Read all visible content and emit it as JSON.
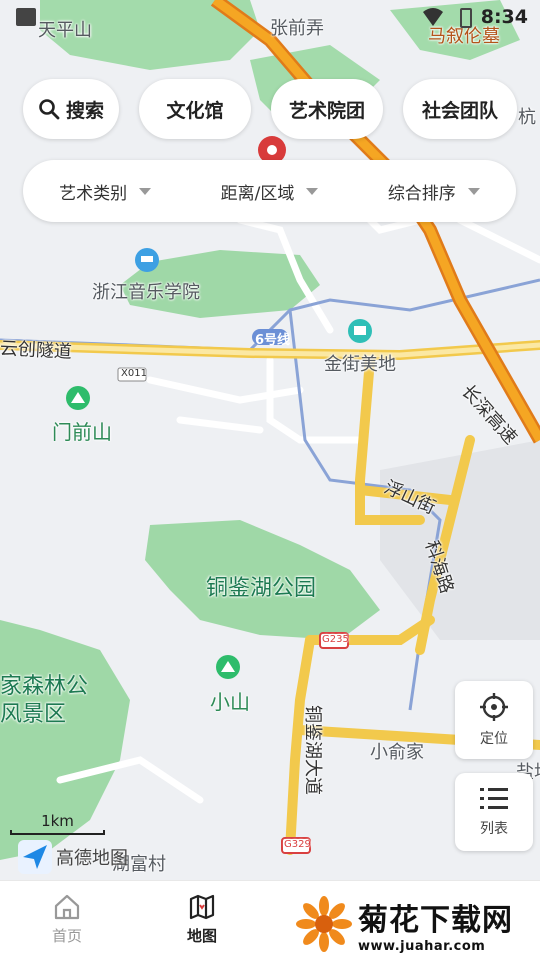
{
  "status_bar": {
    "time": "8:34"
  },
  "map_labels": {
    "tianpingshan": "天平山",
    "zhangqiannong": "张前弄",
    "mashuhuamu": "马叙伦墓",
    "hang": "杭",
    "zhejiang_music": "浙江音乐学院",
    "yunchuang_tunnel": "云创隧道",
    "line6": "6号线",
    "x011": "X011",
    "jinjie_meidi": "金街美地",
    "changqiao_road": "长深高速",
    "menqianshan": "门前山",
    "fushan_street": "浮山街",
    "kehai_road": "科海路",
    "tongjianhu_park": "铜鉴湖公园",
    "forest_park": "家森林公",
    "scenic": "风景区",
    "g235": "G235",
    "xiaoshan": "小山",
    "tongjianhu_ave": "铜鉴湖大道",
    "xiaoyujia": "小俞家",
    "g329": "G329",
    "yanshancun": "湖富村",
    "edge_right": "盐坞"
  },
  "top_tabs": [
    {
      "label": "搜索"
    },
    {
      "label": "文化馆"
    },
    {
      "label": "艺术院团"
    },
    {
      "label": "社会团队"
    }
  ],
  "filters": [
    {
      "label": "艺术类别"
    },
    {
      "label": "距离/区域"
    },
    {
      "label": "综合排序"
    }
  ],
  "fabs": {
    "locate": "定位",
    "list": "列表"
  },
  "scale": "1km",
  "brand": "高德地图",
  "nav": {
    "home": "首页",
    "map": "地图"
  },
  "watermark": {
    "title": "菊花下载网",
    "url": "www.juahar.com"
  },
  "colors": {
    "expressway": "#f5a623",
    "expressway_edge": "#e07b1a",
    "road_yellow": "#f7d35a",
    "park": "#9fd8a7",
    "metro": "#8aa3d6"
  }
}
